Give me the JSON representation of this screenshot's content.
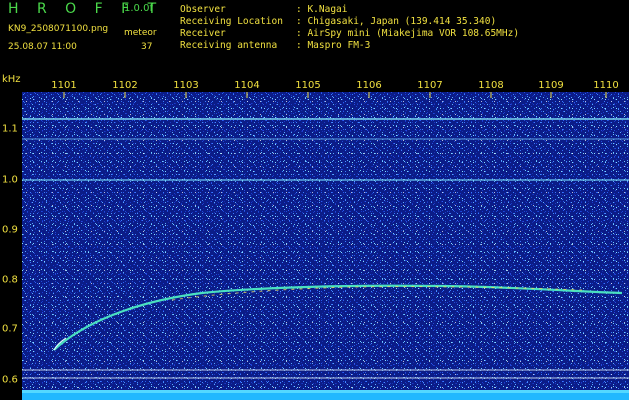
{
  "header": {
    "app_title": "H R O F F T",
    "version": "1.0.0f",
    "filename": "KN9_2508071100.png",
    "mode": "meteor",
    "timestamp": "25.08.07 11:00",
    "count": "37"
  },
  "info": [
    {
      "key": "Observer",
      "value": ": K.Nagai"
    },
    {
      "key": "Receiving Location",
      "value": ": Chigasaki, Japan (139.414 35.340)"
    },
    {
      "key": "Receiver",
      "value": ": AirSpy mini (Miakejima VOR 108.65MHz)"
    },
    {
      "key": "Receiving antenna",
      "value": ": Maspro FM-3"
    }
  ],
  "axis": {
    "unit": "kHz",
    "x_ticks": [
      "1101",
      "1102",
      "1103",
      "1104",
      "1105",
      "1106",
      "1107",
      "1108",
      "1109",
      "1110"
    ],
    "y_ticks": [
      "1.1",
      "1.0",
      "0.9",
      "0.8",
      "0.7",
      "0.6"
    ]
  },
  "colors": {
    "text_yellow": "#f0e040",
    "title_green": "#4ad84a",
    "background": "#000000",
    "noise_base": "#0a1a8a"
  }
}
